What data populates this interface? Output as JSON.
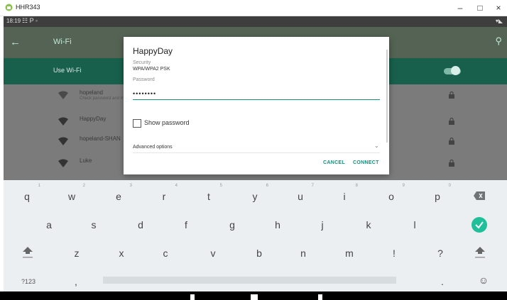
{
  "window": {
    "title": "HHR343",
    "controls": {
      "minimize": "–",
      "maximize": "□",
      "close": "×"
    }
  },
  "status_bar": {
    "time": "18:19",
    "icons": "☷ P ◦",
    "right": "▾◣"
  },
  "wifi": {
    "title": "Wi-Fi",
    "use_wifi_label": "Use Wi-Fi",
    "toggle_on": true,
    "networks": [
      {
        "name": "hopeland",
        "sub": "Check password and try again"
      },
      {
        "name": "HappyDay",
        "sub": ""
      },
      {
        "name": "hopeland-SHAN",
        "sub": ""
      },
      {
        "name": "Luke",
        "sub": ""
      }
    ]
  },
  "dialog": {
    "title": "HappyDay",
    "security_label": "Security",
    "security_value": "WPA/WPA2 PSK",
    "password_label": "Password",
    "password_value": "••••••••",
    "show_password_label": "Show password",
    "advanced_label": "Advanced options",
    "cancel_label": "CANCEL",
    "connect_label": "CONNECT"
  },
  "keyboard": {
    "row1": [
      {
        "k": "q",
        "h": "1"
      },
      {
        "k": "w",
        "h": "2"
      },
      {
        "k": "e",
        "h": "3"
      },
      {
        "k": "r",
        "h": "4"
      },
      {
        "k": "t",
        "h": "5"
      },
      {
        "k": "y",
        "h": "6"
      },
      {
        "k": "u",
        "h": "7"
      },
      {
        "k": "i",
        "h": "8"
      },
      {
        "k": "o",
        "h": "9"
      },
      {
        "k": "p",
        "h": "0"
      }
    ],
    "row2": [
      "a",
      "s",
      "d",
      "f",
      "g",
      "h",
      "j",
      "k",
      "l"
    ],
    "row3": [
      "z",
      "x",
      "c",
      "v",
      "b",
      "n",
      "m",
      "!",
      "?"
    ],
    "symbols_label": "?123",
    "comma": ",",
    "period": ".",
    "emoji": "☺"
  },
  "colors": {
    "accent": "#148f79",
    "toolbar": "#556354",
    "use_wifi_bg": "#185f4c",
    "enter_key": "#1fbf9a"
  }
}
